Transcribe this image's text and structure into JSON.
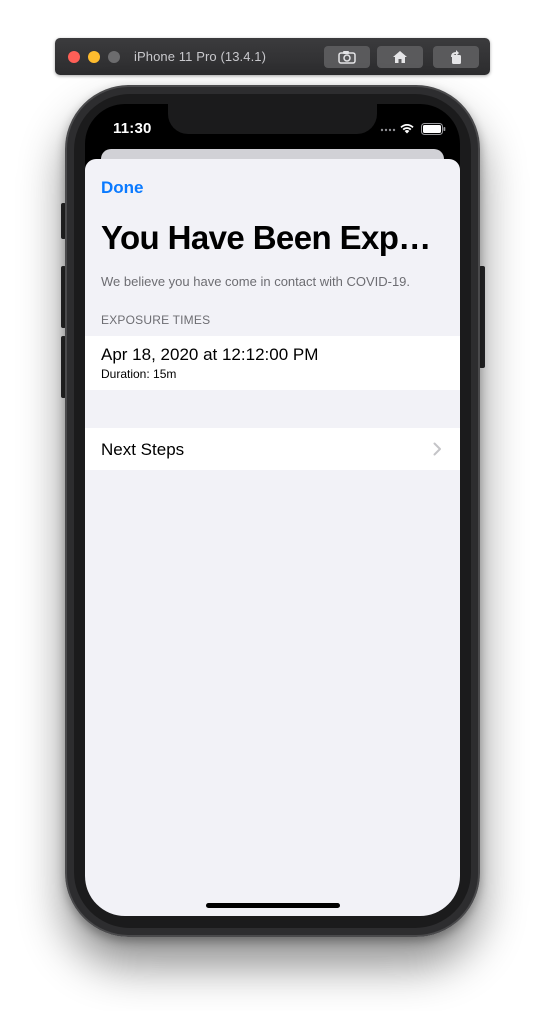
{
  "simulator": {
    "title": "iPhone 11 Pro (13.4.1)",
    "buttons": [
      "screenshot-icon",
      "home-icon",
      "rotate-icon"
    ]
  },
  "status_bar": {
    "time": "11:30"
  },
  "sheet": {
    "done_label": "Done",
    "title": "You Have Been Exposed",
    "subtitle": "We believe you have come in contact with COVID-19.",
    "section_header": "EXPOSURE TIMES",
    "exposures": [
      {
        "date": "Apr 18, 2020 at 12:12:00 PM",
        "duration": "Duration: 15m"
      }
    ],
    "next_steps_label": "Next Steps"
  },
  "colors": {
    "accent": "#0a7aff",
    "grouped_background": "#f2f2f7",
    "secondary_text": "#6d6d72"
  }
}
